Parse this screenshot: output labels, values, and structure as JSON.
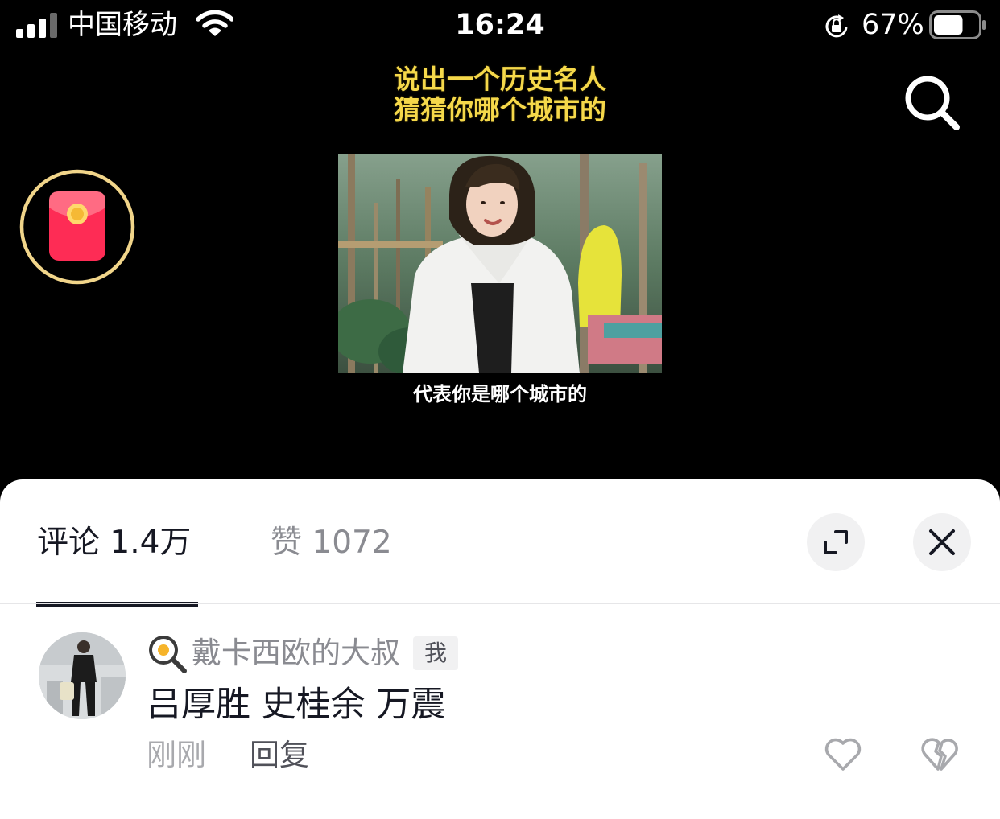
{
  "status_bar": {
    "carrier": "中国移动",
    "time": "16:24",
    "battery_percent": "67%",
    "battery_level": 0.67,
    "icons": [
      "signal-icon",
      "wifi-icon",
      "rotation-lock-icon",
      "battery-icon"
    ]
  },
  "video": {
    "title_line1": "说出一个历史名人",
    "title_line2": "猜猜你哪个城市的",
    "subtitle": "代表你是哪个城市的",
    "title_color": "#f5d84a"
  },
  "comments_panel": {
    "tabs": [
      {
        "label": "评论 1.4万",
        "active": true
      },
      {
        "label": "赞 1072",
        "active": false
      }
    ],
    "expand_icon": "expand-icon",
    "close_icon": "close-icon",
    "comment": {
      "emoji_icon": "frying-pan-egg-icon",
      "username": "戴卡西欧的大叔",
      "badge": "我",
      "text": "吕厚胜 史桂余 万震",
      "time": "刚刚",
      "reply_label": "回复",
      "like_icon": "heart-icon",
      "dislike_icon": "broken-heart-icon"
    }
  },
  "colors": {
    "accent_red": "#fe2c55",
    "ring_gold": "#f1d58a",
    "text_primary": "#161823",
    "text_secondary": "#8a8b91"
  }
}
